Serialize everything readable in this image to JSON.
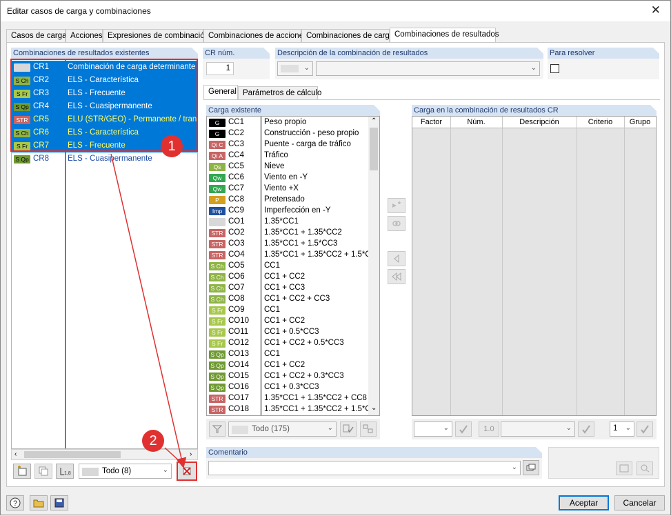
{
  "window": {
    "title": "Editar casos de carga y combinaciones",
    "close": "✕"
  },
  "tabs": [
    {
      "label": "Casos de carga"
    },
    {
      "label": "Acciones"
    },
    {
      "label": "Expresiones de combinación"
    },
    {
      "label": "Combinaciones de acciones"
    },
    {
      "label": "Combinaciones de carga"
    },
    {
      "label": "Combinaciones de resultados"
    }
  ],
  "left": {
    "header": "Combinaciones de resultados existentes",
    "items": [
      {
        "badge": "",
        "bcolor": "#d8d8d8",
        "btext": "#000",
        "id": "CR1",
        "desc": "Combinación de carga determinante"
      },
      {
        "badge": "S Ch",
        "bcolor": "#8fb446",
        "btext": "#000",
        "id": "CR2",
        "desc": "ELS - Característica"
      },
      {
        "badge": "S Fr",
        "bcolor": "#a8c84c",
        "btext": "#000",
        "id": "CR3",
        "desc": "ELS - Frecuente"
      },
      {
        "badge": "S Qp",
        "bcolor": "#6f9a32",
        "btext": "#000",
        "id": "CR4",
        "desc": "ELS - Cuasipermanente"
      },
      {
        "badge": "STR",
        "bcolor": "#c86464",
        "btext": "#fff",
        "id": "CR5",
        "desc": "ELU (STR/GEO) - Permanente / transitoria"
      },
      {
        "badge": "S Ch",
        "bcolor": "#8fb446",
        "btext": "#000",
        "id": "CR6",
        "desc": "ELS - Característica"
      },
      {
        "badge": "S Fr",
        "bcolor": "#a8c84c",
        "btext": "#000",
        "id": "CR7",
        "desc": "ELS - Frecuente"
      },
      {
        "badge": "S Qp",
        "bcolor": "#6f9a32",
        "btext": "#000",
        "id": "CR8",
        "desc": "ELS - Cuasipermanente"
      }
    ],
    "filter": "Todo (8)"
  },
  "markers": {
    "m1": "1",
    "m2": "2"
  },
  "cr_num": {
    "label": "CR núm.",
    "value": "1"
  },
  "description": {
    "label": "Descripción de la combinación de resultados"
  },
  "para_resolver": {
    "label": "Para resolver"
  },
  "subtabs": [
    {
      "label": "General"
    },
    {
      "label": "Parámetros de cálculo"
    }
  ],
  "existing": {
    "header": "Carga existente",
    "items": [
      {
        "badge": "G",
        "bcolor": "#000000",
        "id": "CC1",
        "desc": "Peso propio"
      },
      {
        "badge": "G",
        "bcolor": "#000000",
        "id": "CC2",
        "desc": "Construcción - peso propio"
      },
      {
        "badge": "Qi C",
        "bcolor": "#c86464",
        "id": "CC3",
        "desc": "Puente - carga de tráfico"
      },
      {
        "badge": "Qi A",
        "bcolor": "#c86464",
        "id": "CC4",
        "desc": "Tráfico"
      },
      {
        "badge": "Qs",
        "bcolor": "#8fb446",
        "id": "CC5",
        "desc": "Nieve"
      },
      {
        "badge": "Qw",
        "bcolor": "#33a852",
        "id": "CC6",
        "desc": "Viento en -Y"
      },
      {
        "badge": "Qw",
        "bcolor": "#33a852",
        "id": "CC7",
        "desc": "Viento +X"
      },
      {
        "badge": "P",
        "bcolor": "#d4a020",
        "id": "CC8",
        "desc": "Pretensado"
      },
      {
        "badge": "Imp",
        "bcolor": "#2050a0",
        "id": "CC9",
        "desc": "Imperfección en -Y"
      },
      {
        "badge": "",
        "bcolor": "#d8d8d8",
        "id": "CO1",
        "desc": "1.35*CC1"
      },
      {
        "badge": "STR",
        "bcolor": "#c86464",
        "id": "CO2",
        "desc": "1.35*CC1 + 1.35*CC2"
      },
      {
        "badge": "STR",
        "bcolor": "#c86464",
        "id": "CO3",
        "desc": "1.35*CC1 + 1.5*CC3"
      },
      {
        "badge": "STR",
        "bcolor": "#c86464",
        "id": "CO4",
        "desc": "1.35*CC1 + 1.35*CC2 + 1.5*C"
      },
      {
        "badge": "S Ch",
        "bcolor": "#8fb446",
        "id": "CO5",
        "desc": "CC1"
      },
      {
        "badge": "S Ch",
        "bcolor": "#8fb446",
        "id": "CO6",
        "desc": "CC1 + CC2"
      },
      {
        "badge": "S Ch",
        "bcolor": "#8fb446",
        "id": "CO7",
        "desc": "CC1 + CC3"
      },
      {
        "badge": "S Ch",
        "bcolor": "#8fb446",
        "id": "CO8",
        "desc": "CC1 + CC2 + CC3"
      },
      {
        "badge": "S Fr",
        "bcolor": "#a8c84c",
        "id": "CO9",
        "desc": "CC1"
      },
      {
        "badge": "S Fr",
        "bcolor": "#a8c84c",
        "id": "CO10",
        "desc": "CC1 + CC2"
      },
      {
        "badge": "S Fr",
        "bcolor": "#a8c84c",
        "id": "CO11",
        "desc": "CC1 + 0.5*CC3"
      },
      {
        "badge": "S Fr",
        "bcolor": "#a8c84c",
        "id": "CO12",
        "desc": "CC1 + CC2 + 0.5*CC3"
      },
      {
        "badge": "S Qp",
        "bcolor": "#6f9a32",
        "id": "CO13",
        "desc": "CC1"
      },
      {
        "badge": "S Qp",
        "bcolor": "#6f9a32",
        "id": "CO14",
        "desc": "CC1 + CC2"
      },
      {
        "badge": "S Qp",
        "bcolor": "#6f9a32",
        "id": "CO15",
        "desc": "CC1 + CC2 + 0.3*CC3"
      },
      {
        "badge": "S Qp",
        "bcolor": "#6f9a32",
        "id": "CO16",
        "desc": "CC1 + 0.3*CC3"
      },
      {
        "badge": "STR",
        "bcolor": "#c86464",
        "id": "CO17",
        "desc": "1.35*CC1 + 1.35*CC2 + CC8"
      },
      {
        "badge": "STR",
        "bcolor": "#c86464",
        "id": "CO18",
        "desc": "1.35*CC1 + 1.35*CC2 + 1.5*C"
      }
    ],
    "filter": "Todo (175)"
  },
  "right": {
    "header": "Carga en la combinación de resultados CR",
    "columns": [
      "Factor",
      "Núm.",
      "Descripción",
      "Criterio",
      "Grupo"
    ],
    "factor_value": "1.0",
    "group_value": "1"
  },
  "comment": {
    "label": "Comentario"
  },
  "footer": {
    "accept": "Aceptar",
    "cancel": "Cancelar"
  },
  "colors": {
    "selection": "#0078d7",
    "annotation": "#e03030",
    "header": "#d6e3f3"
  }
}
